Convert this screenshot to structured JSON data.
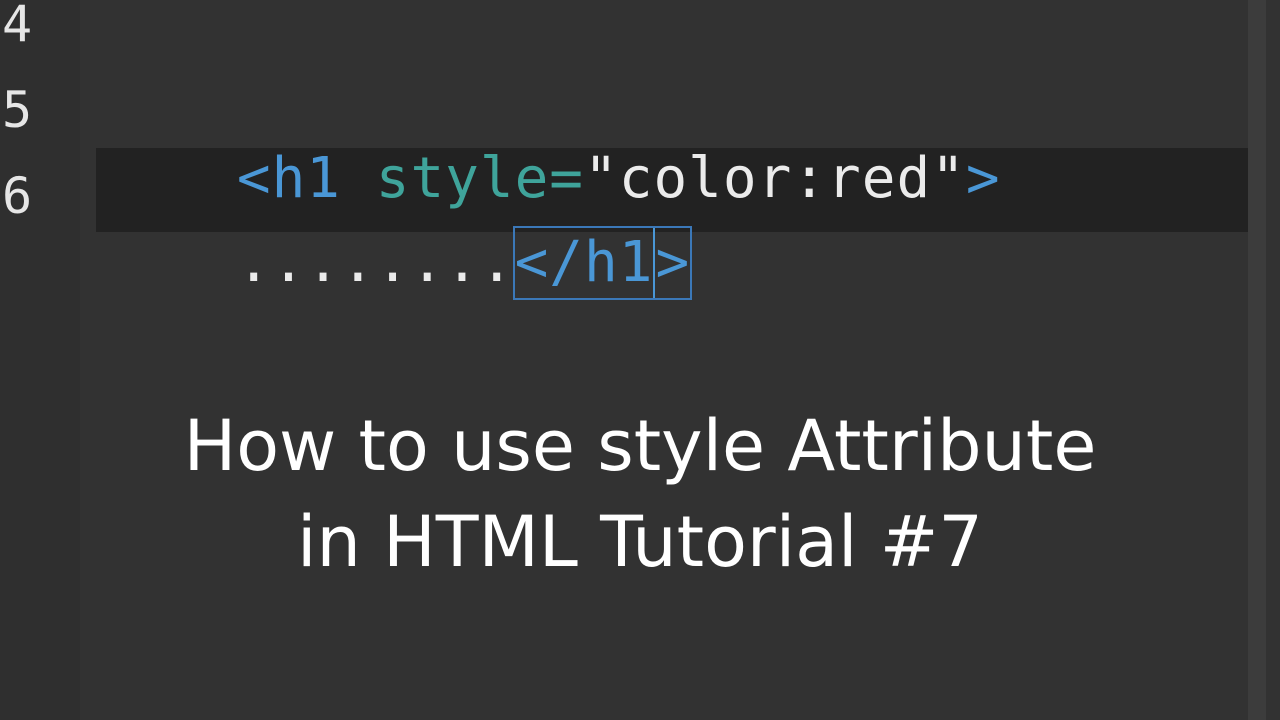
{
  "editor": {
    "line_numbers": [
      "4",
      "5",
      "6"
    ],
    "line5": {
      "tag_open": "<h1",
      "space": " ",
      "attr": "style=",
      "value": "\"color:red\"",
      "tag_end": ">"
    },
    "line6": {
      "indent_dots": "........",
      "close_tag_body": "</h1",
      "close_tag_end": ">"
    }
  },
  "overlay": {
    "title_line1": "How to use style Attribute",
    "title_line2": "in HTML Tutorial #7"
  },
  "colors": {
    "background": "#323232",
    "active_line": "#222222",
    "tag": "#4a97d6",
    "attribute": "#3fa49b",
    "string": "#ebebeb",
    "bracket_match": "#3b78b8"
  }
}
